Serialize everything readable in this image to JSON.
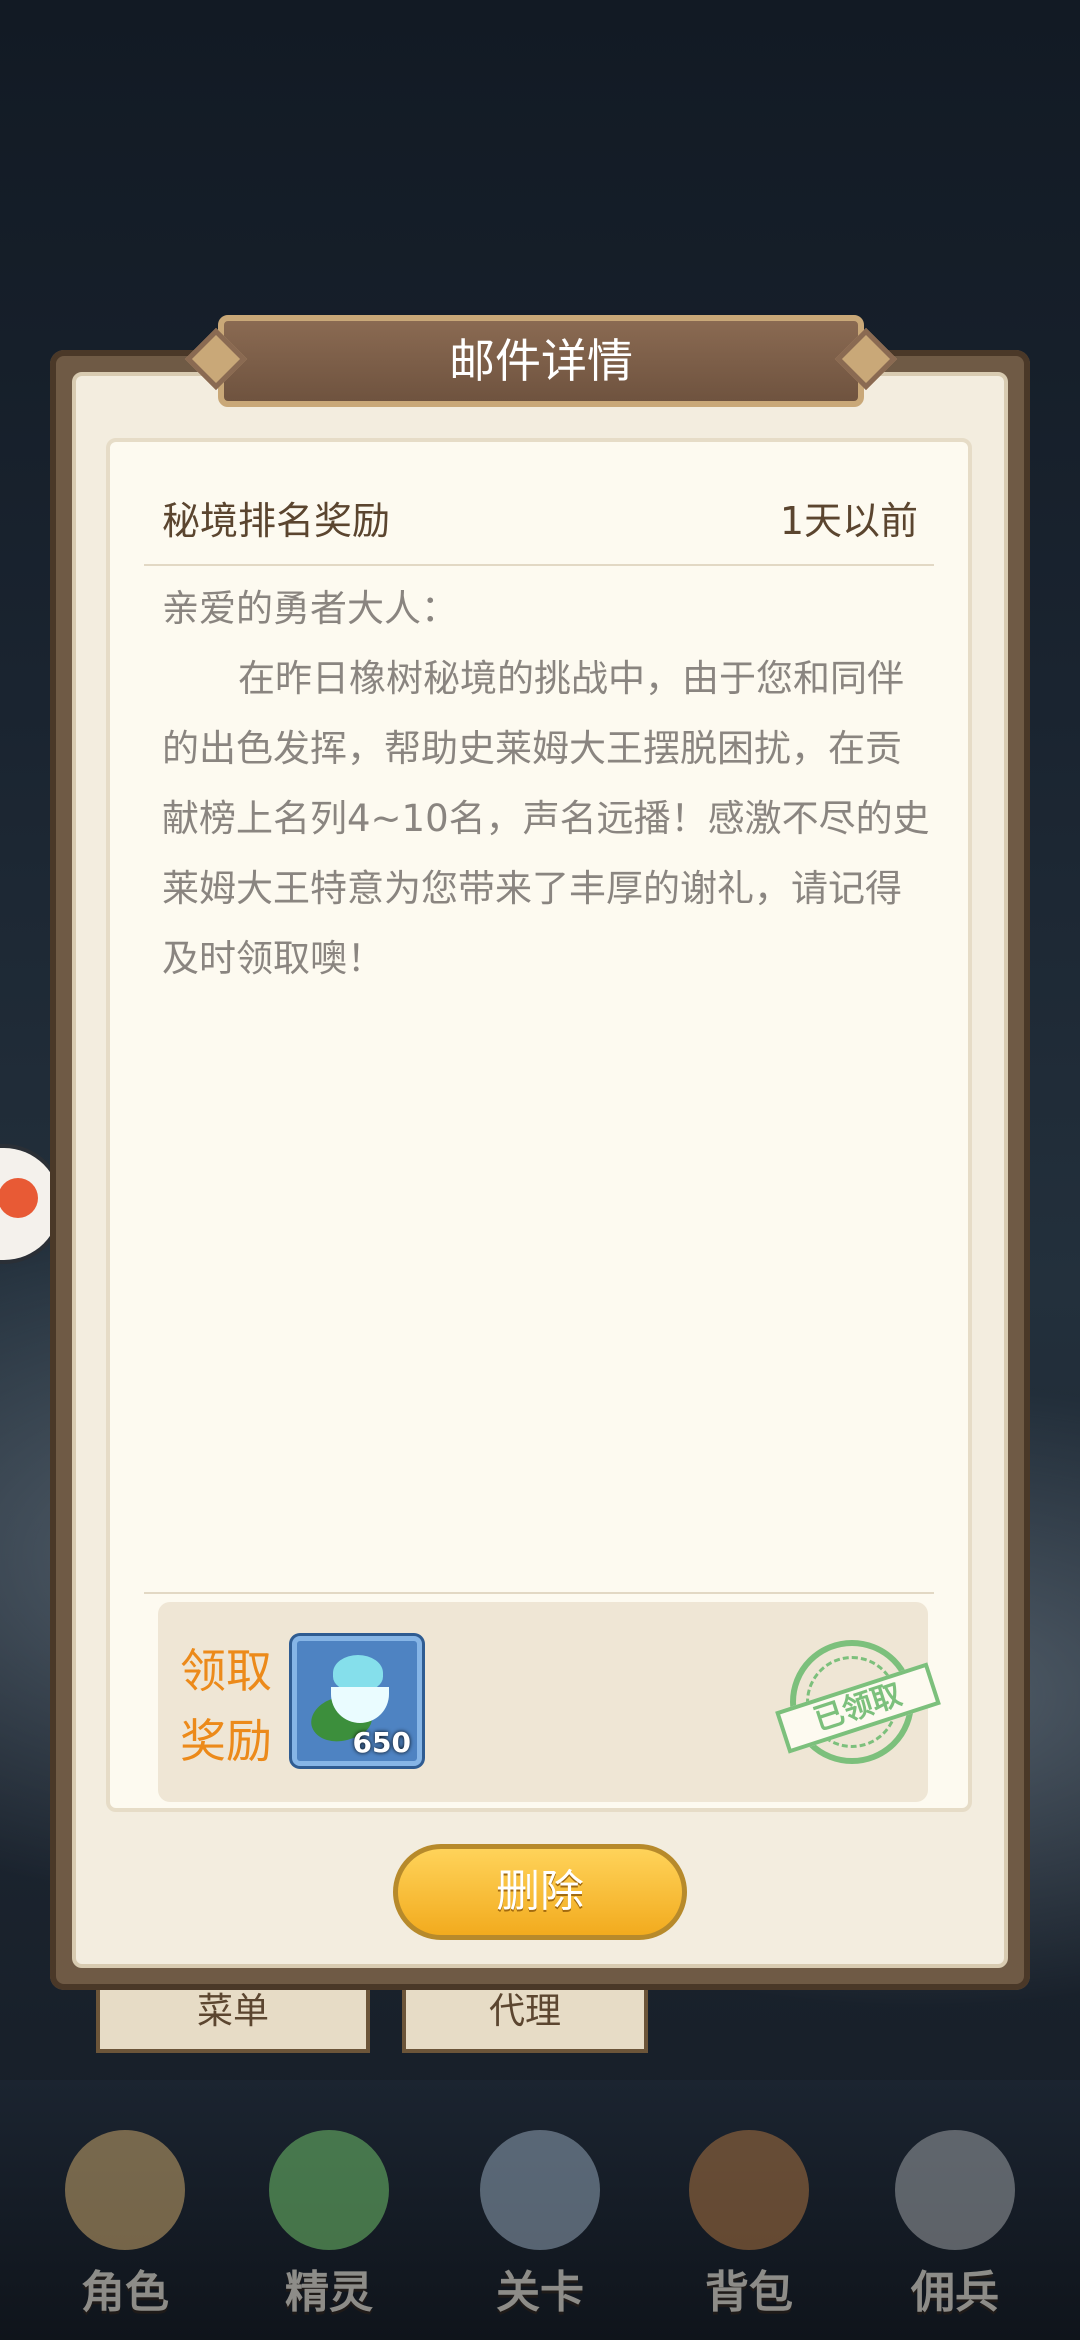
{
  "modal": {
    "title": "邮件详情",
    "subject": "秘境排名奖励",
    "time": "1天以前",
    "greeting": "亲爱的勇者大人：",
    "body": "在昨日橡树秘境的挑战中，由于您和同伴的出色发挥，帮助史莱姆大王摆脱困扰，在贡献榜上名列4~10名，声名远播！感激不尽的史莱姆大王特意为您带来了丰厚的谢礼，请记得及时领取噢！",
    "reward_label": "领取奖励",
    "reward_item": {
      "icon": "flame-bowl-icon",
      "count": "650"
    },
    "stamp": "已领取",
    "delete_label": "删除"
  },
  "background_tabs": [
    "菜单",
    "代理"
  ],
  "bottom_nav": [
    {
      "label": "角色",
      "icon": "character-icon"
    },
    {
      "label": "精灵",
      "icon": "spirit-icon"
    },
    {
      "label": "关卡",
      "icon": "stage-icon"
    },
    {
      "label": "背包",
      "icon": "backpack-icon"
    },
    {
      "label": "佣兵",
      "icon": "mercenary-icon"
    }
  ],
  "colors": {
    "reward_label": "#ec8a1a",
    "stamp": "#7cc07c",
    "delete_button": "#f2ab1e",
    "title_banner": "#6f533f"
  }
}
